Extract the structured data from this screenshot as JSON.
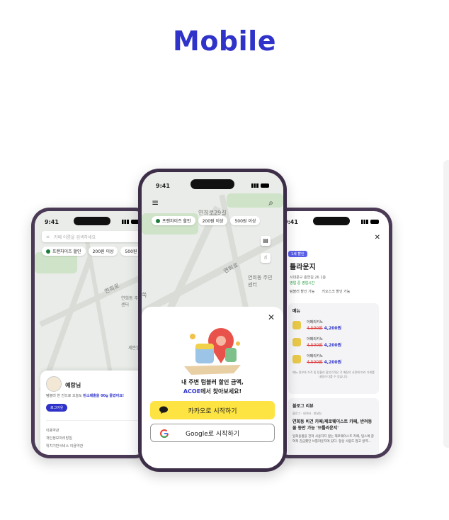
{
  "page_title": "Mobile",
  "status_time": "9:41",
  "filters": {
    "franchise": "프랜차이즈 할인",
    "over200": "200원 이상",
    "over500": "500원 이상"
  },
  "left": {
    "search_placeholder": "카페 이름을 검색하세요",
    "map_label_1": "연희로",
    "map_label_2": "연희동 주민센터",
    "map_label_3": "세븐일",
    "user_name": "예랑님",
    "user_desc_prefix": "텀블러 한 잔으로 오늘도",
    "user_desc_highlight": "탄소배출을 00g 줄였어요!",
    "login_label": "로그아웃",
    "menu": [
      "이용약관",
      "개인정보처리방침",
      "위치기반서비스 이용약관"
    ]
  },
  "center": {
    "map_label_1": "연희로",
    "map_label_2": "연희동 주민센터",
    "map_label_3": "연희로29길",
    "map_label_4": "쑥",
    "message_line1": "내 주변 텀블러 할인 금액,",
    "message_brand": "ACOE",
    "message_line2_suffix": "에서 찾아보세요!",
    "kakao_label": "카카오로 시작하기",
    "google_label": "Google로 시작하기"
  },
  "right": {
    "badge": "1세 할인",
    "title": "틀라운지",
    "address": "서대문구 홍연길 26 1층",
    "open": "영업 중 영업시간",
    "tag1": "텀블러 할인 가능",
    "tag2": "키오스크 할인 가능",
    "menu_title": "메뉴",
    "items": [
      {
        "name": "아메리카노",
        "original": "4,500원",
        "discount": "4,200원"
      },
      {
        "name": "아메리카노",
        "original": "4,500원",
        "discount": "4,200원"
      },
      {
        "name": "아메리카노",
        "original": "4,500원",
        "discount": "4,200원"
      }
    ],
    "menu_note": "메뉴 정보와 가격 및 텀블러 할인가격은 각 매장의 사정에 따라 가게를 내용과 다를 수 있습니다.",
    "blog_title": "블로그 리뷰",
    "blog_meta": "블로그 · 네이버 · 한살림",
    "blog_head": "연희동 비건 카페/제로웨이스트 카페, 반려동물 동반 가능 '브틀라운지'",
    "blog_body": "일회용품을 전혀 사용하지 않는 제로웨이스트 카페, 텀스에 참여적 감금했던 브틀라운지에 갔다. 항상 사람도 많고 방역..."
  },
  "colors": {
    "brand": "#2f33c9",
    "kakao": "#fee442",
    "phone_frame": "#4a3a55"
  }
}
